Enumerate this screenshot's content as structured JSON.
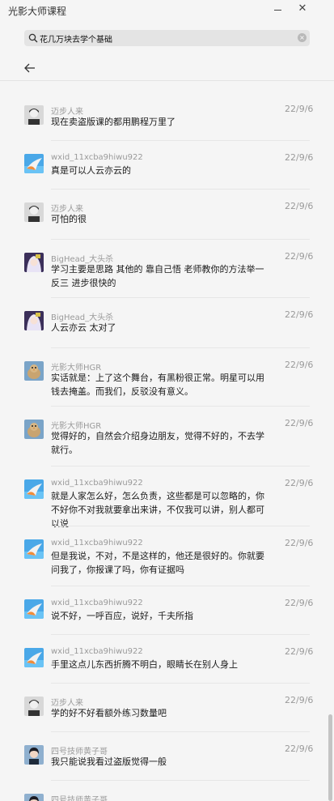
{
  "app": {
    "title": "光影大师课程"
  },
  "window": {
    "minimize_icon": "minimize-icon",
    "close_symbol": "✕"
  },
  "search": {
    "value": "花几万块去学个基础",
    "clear_symbol": "×"
  },
  "messages": [
    {
      "name": "迈步人来",
      "date": "22/9/6",
      "text": "现在卖盗版课的都用鹏程万里了",
      "avatar": "gray-user"
    },
    {
      "name": "wxid_11xcba9hiwu922",
      "date": "22/9/6",
      "text": "真是可以人云亦云的",
      "avatar": "shark"
    },
    {
      "name": "迈步人来",
      "date": "22/9/6",
      "text": "可怕的很",
      "avatar": "gray-user"
    },
    {
      "name": "BigHead_大头杀",
      "date": "22/9/6",
      "text": "学习主要是思路 其他的 靠自己悟 老师教你的方法举一反三 进步很快的",
      "avatar": "anime"
    },
    {
      "name": "BigHead_大头杀",
      "date": "22/9/6",
      "text": "人云亦云   太对了",
      "avatar": "anime"
    },
    {
      "name": "光影大师HGR",
      "date": "22/9/6",
      "text": "实话就是：上了这个舞台，有黑粉很正常。明星可以用钱去掩盖。而我们，反驳没有意义。",
      "avatar": "bird"
    },
    {
      "name": "光影大师HGR",
      "date": "22/9/6",
      "text": "觉得好的，自然会介绍身边朋友，觉得不好的，不去学就行。",
      "avatar": "bird"
    },
    {
      "name": "wxid_11xcba9hiwu922",
      "date": "22/9/6",
      "text": "就是人家怎么好，怎么负责，这些都是可以忽略的，你不好你不对我就要拿出来讲，不仅我可以讲，别人都可以说",
      "avatar": "shark"
    },
    {
      "name": "wxid_11xcba9hiwu922",
      "date": "22/9/6",
      "text": "但是我说，不对，不是这样的，他还是很好的。你就要问我了，你报课了吗，你有证据吗",
      "avatar": "shark"
    },
    {
      "name": "wxid_11xcba9hiwu922",
      "date": "22/9/6",
      "text": "说不好，一呼百应，说好，千夫所指",
      "avatar": "shark"
    },
    {
      "name": "wxid_11xcba9hiwu922",
      "date": "22/9/6",
      "text": "手里这点儿东西折腾不明白，眼睛长在别人身上",
      "avatar": "shark"
    },
    {
      "name": "迈步人来",
      "date": "22/9/6",
      "text": "学的好不好看额外练习数量吧",
      "avatar": "gray-user"
    },
    {
      "name": "四号技师黄子哥",
      "date": "22/9/6",
      "text": "我只能说我看过盗版觉得一般",
      "avatar": "dark-hair"
    },
    {
      "name": "四号技师黄子哥",
      "date": "",
      "text": "",
      "avatar": "dark-hair"
    }
  ]
}
